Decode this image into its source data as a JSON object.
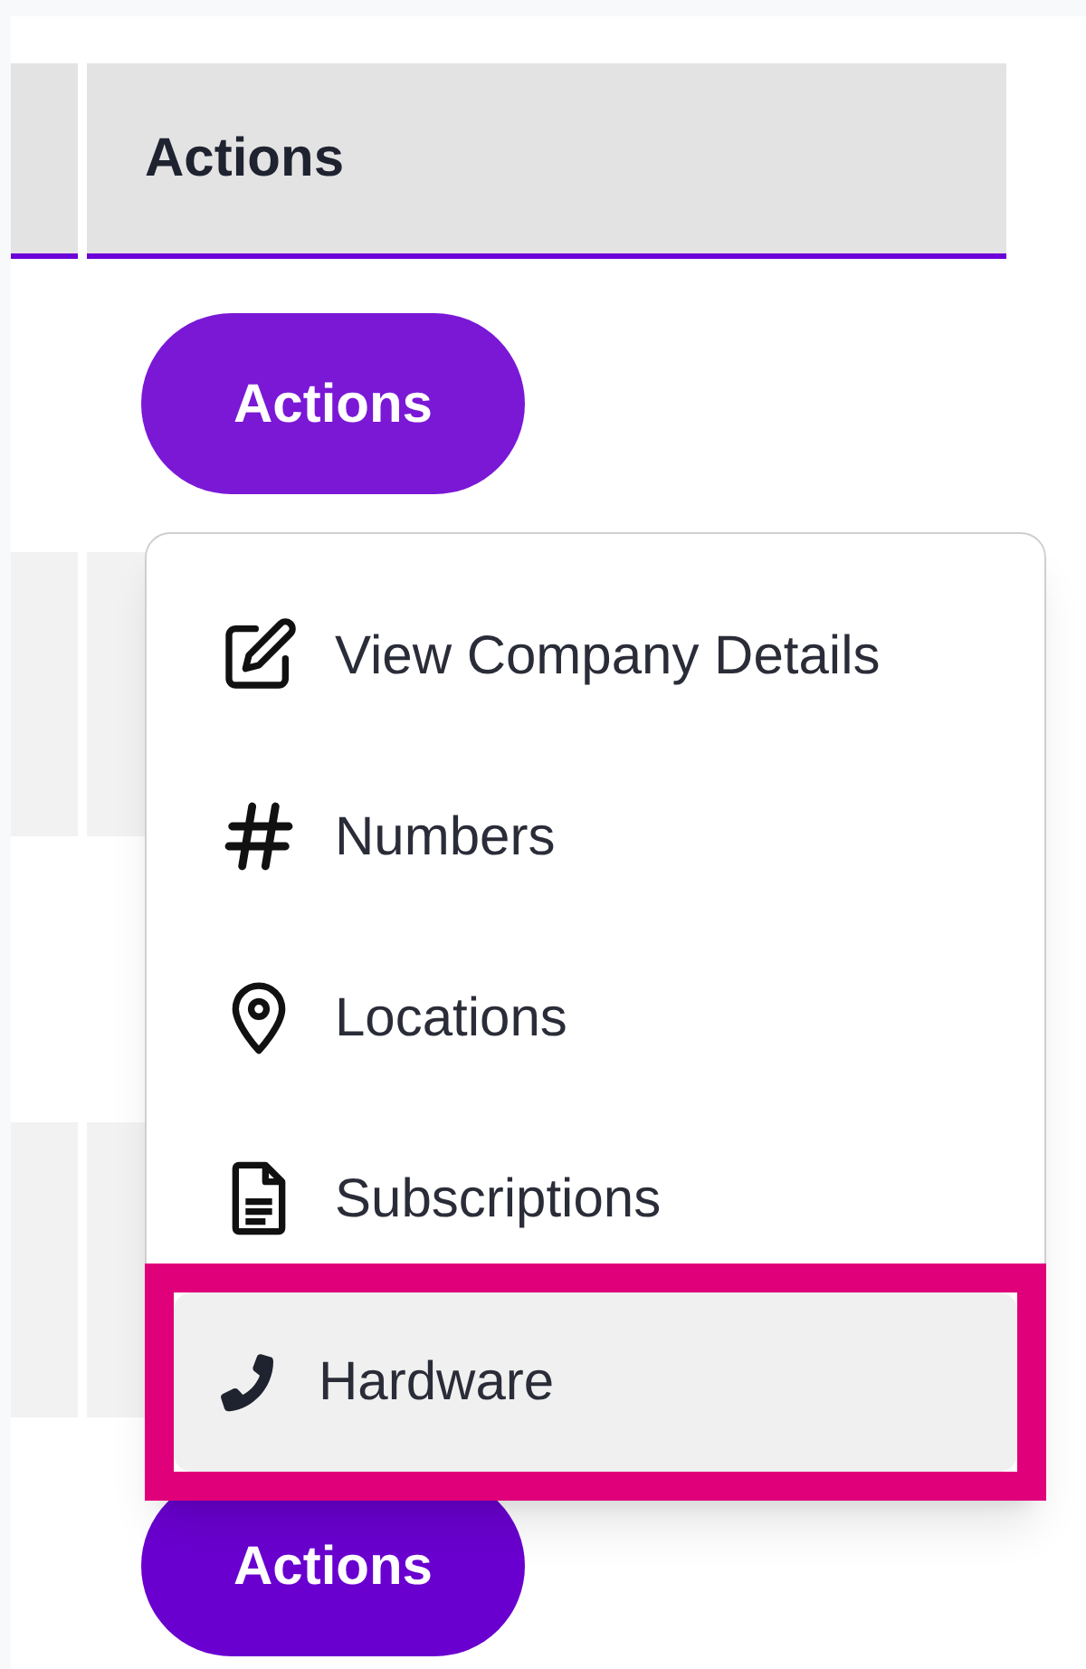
{
  "table": {
    "column_header": "Actions",
    "action_buttons": [
      "Actions",
      "Actions"
    ]
  },
  "menu": {
    "items": [
      {
        "label": "View Company Details",
        "highlighted": false
      },
      {
        "label": "Numbers",
        "highlighted": false
      },
      {
        "label": "Locations",
        "highlighted": false
      },
      {
        "label": "Subscriptions",
        "highlighted": false
      },
      {
        "label": "Hardware",
        "highlighted": true
      }
    ]
  }
}
